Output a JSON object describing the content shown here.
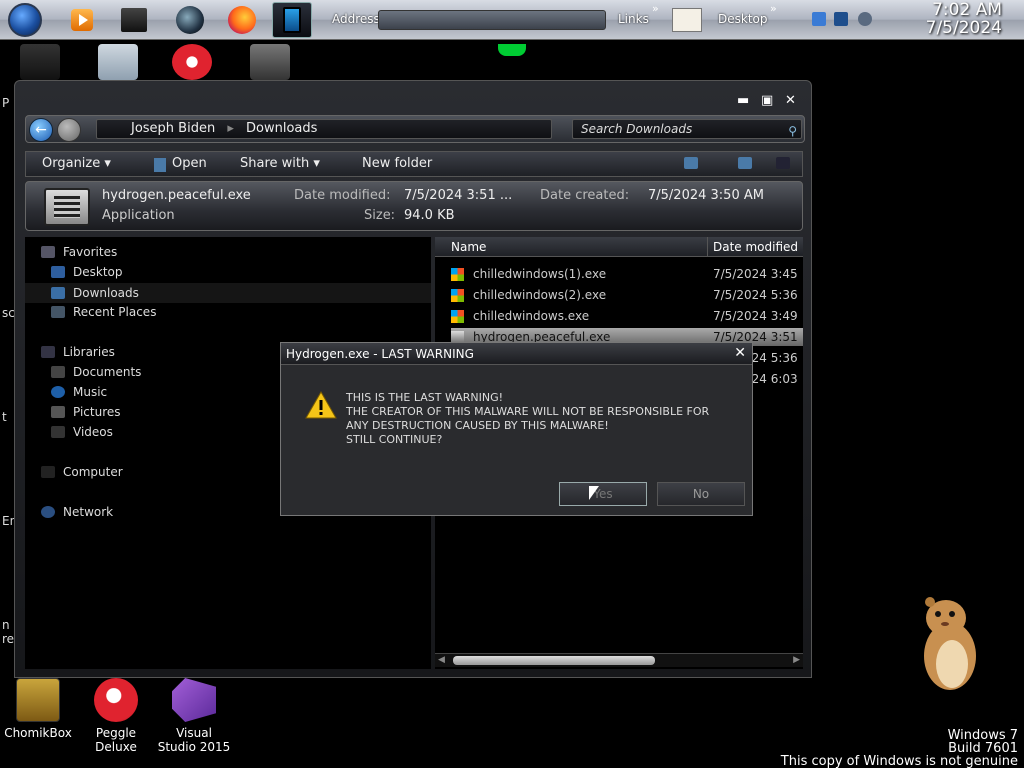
{
  "taskbar": {
    "address_label": "Address",
    "links_label": "Links",
    "desktop_label": "Desktop",
    "chevron": "»",
    "clock_time": "7:02 AM",
    "clock_date": "7/5/2024"
  },
  "desktop_icons": [
    {
      "label": "ChomikBox"
    },
    {
      "label": "Peggle Deluxe"
    },
    {
      "label": "Visual Studio 2015"
    }
  ],
  "edge_letters": [
    "P",
    "sc",
    "t",
    "En",
    "n",
    "re"
  ],
  "explorer": {
    "breadcrumb": [
      "Joseph Biden",
      "Downloads"
    ],
    "search_placeholder": "Search Downloads",
    "commands": {
      "organize": "Organize ▾",
      "open": "Open",
      "share": "Share with ▾",
      "new_folder": "New folder"
    },
    "details": {
      "file_name": "hydrogen.peaceful.exe",
      "modified_label": "Date modified:",
      "modified_value": "7/5/2024 3:51 ...",
      "created_label": "Date created:",
      "created_value": "7/5/2024 3:50 AM",
      "type": "Application",
      "size_label": "Size:",
      "size_value": "94.0 KB"
    },
    "nav": {
      "favorites": "Favorites",
      "desktop": "Desktop",
      "downloads": "Downloads",
      "recent": "Recent Places",
      "libraries": "Libraries",
      "documents": "Documents",
      "music": "Music",
      "pictures": "Pictures",
      "videos": "Videos",
      "computer": "Computer",
      "network": "Network"
    },
    "columns": {
      "name": "Name",
      "date_modified": "Date modified"
    },
    "files": [
      {
        "name": "chilledwindows(1).exe",
        "date": "7/5/2024 3:45"
      },
      {
        "name": "chilledwindows(2).exe",
        "date": "7/5/2024 5:36"
      },
      {
        "name": "chilledwindows.exe",
        "date": "7/5/2024 3:49"
      },
      {
        "name": "hydrogen.peaceful.exe",
        "date": "7/5/2024 3:51"
      },
      {
        "name": "",
        "date": "7/5/2024 5:36"
      },
      {
        "name": "",
        "date": "7/5/2024 6:03"
      }
    ]
  },
  "dialog": {
    "title": "Hydrogen.exe - LAST WARNING",
    "message": "THIS IS THE LAST WARNING!\nTHE CREATOR OF THIS MALWARE WILL NOT BE RESPONSIBLE FOR\nANY DESTRUCTION CAUSED BY THIS MALWARE!\nSTILL CONTINUE?",
    "yes": "Yes",
    "no": "No",
    "close": "✕"
  },
  "watermark": {
    "line1": "Windows 7",
    "line2": "Build 7601",
    "line3": "This copy of Windows is not genuine"
  }
}
